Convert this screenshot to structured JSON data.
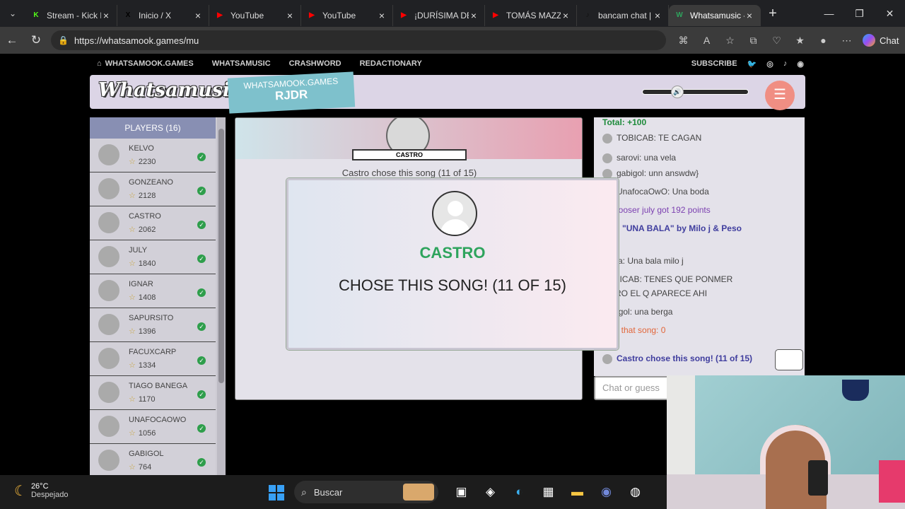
{
  "browser": {
    "tabs": [
      {
        "title": "Stream - Kick D",
        "fav": "K",
        "favcolor": "#53fc18"
      },
      {
        "title": "Inicio / X",
        "fav": "X",
        "favcolor": "#000000"
      },
      {
        "title": "YouTube",
        "fav": "▶",
        "favcolor": "#ff0000"
      },
      {
        "title": "YouTube",
        "fav": "▶",
        "favcolor": "#ff0000"
      },
      {
        "title": "¡DURÍSIMA DE",
        "fav": "▶",
        "favcolor": "#ff0000"
      },
      {
        "title": "TOMÁS MAZZA",
        "fav": "▶",
        "favcolor": "#ff0000"
      },
      {
        "title": "bancam chat |",
        "fav": "♪",
        "favcolor": "#111111"
      },
      {
        "title": "Whatsamusic -",
        "fav": "W",
        "favcolor": "#2ea45d"
      }
    ],
    "url": "https://whatsamook.games/mu",
    "chat_label": "Chat"
  },
  "site": {
    "nav": [
      "WHATSAMOOK.GAMES",
      "WHATSAMUSIC",
      "CRASHWORD",
      "REDACTIONARY"
    ],
    "subscribe": "SUBSCRIBE",
    "logo": "Whatsamusic",
    "badge_line1": "WHATSAMOOK.GAMES",
    "badge_line2": "RJDR"
  },
  "players": {
    "header": "PLAYERS (16)",
    "list": [
      {
        "name": "KELVO",
        "points": "2230"
      },
      {
        "name": "GONZEANO",
        "points": "2128"
      },
      {
        "name": "CASTRO",
        "points": "2062"
      },
      {
        "name": "JULY",
        "points": "1840"
      },
      {
        "name": "IGNAR",
        "points": "1408"
      },
      {
        "name": "SAPURSITO",
        "points": "1396"
      },
      {
        "name": "FACUXCARP",
        "points": "1334"
      },
      {
        "name": "TIAGO BANEGA",
        "points": "1170"
      },
      {
        "name": "UNAFOCAOWO",
        "points": "1056"
      },
      {
        "name": "GABIGOL",
        "points": "764"
      }
    ]
  },
  "song": {
    "chooser": "CASTRO",
    "subtitle": "Castro chose this song (11 of 15)"
  },
  "chat": {
    "lines": [
      {
        "text": "Total: +100",
        "style": "g",
        "avatar": false
      },
      {
        "text": "TOBICAB: TE CAGAN",
        "style": "",
        "avatar": true
      },
      {
        "text": "sarovi: una vela",
        "style": "",
        "avatar": true
      },
      {
        "text": "gabigol: unn answdw}",
        "style": "",
        "avatar": true
      },
      {
        "text": "UnafocaOwO: Una boda",
        "style": "",
        "avatar": true
      },
      {
        "text": "g chooser july got 192 points",
        "style": "p",
        "avatar": false
      },
      {
        "text": "wer: \"UNA BALA\" by Milo j & Peso",
        "style": "b",
        "avatar": false
      },
      {
        "text": "na",
        "style": "b",
        "avatar": false
      },
      {
        "text": "Silvia: Una bala milo j",
        "style": "",
        "avatar": false
      },
      {
        "text": "TOBICAB: TENES QUE PONMER",
        "style": "",
        "avatar": false
      },
      {
        "text": "MERO EL Q APARECE AHI",
        "style": "",
        "avatar": false
      },
      {
        "text": "gabigol: una berga",
        "style": "",
        "avatar": false
      },
      {
        "text": "s for that song: 0",
        "style": "o",
        "avatar": false
      },
      {
        "text": "Castro chose this song! (11 of 15)",
        "style": "b",
        "avatar": true
      }
    ],
    "input_placeholder": "Chat or guess"
  },
  "modal": {
    "name": "CASTRO",
    "text": "CHOSE THIS SONG! (11 OF 15)"
  },
  "taskbar": {
    "temp": "26°C",
    "weather": "Despejado",
    "search": "Buscar"
  }
}
